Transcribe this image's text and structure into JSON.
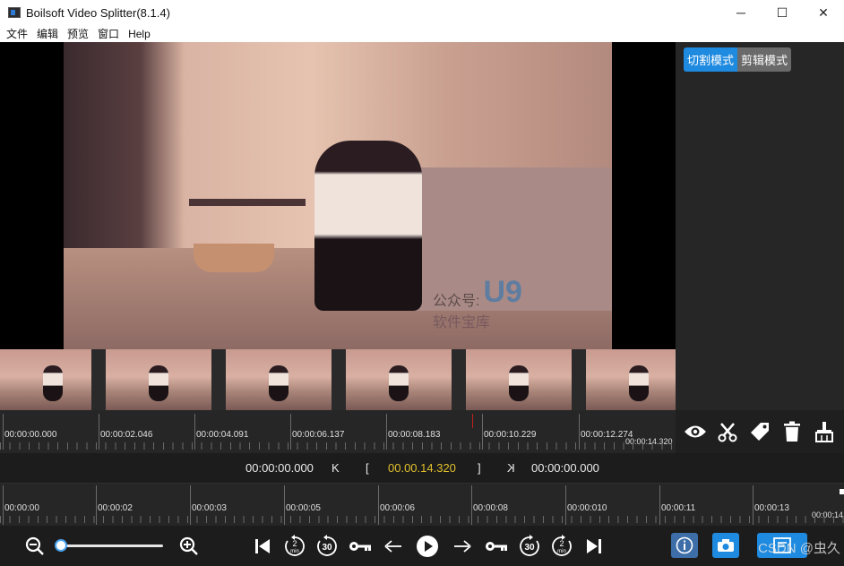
{
  "window": {
    "title": "Boilsoft Video Splitter(8.1.4)"
  },
  "window_controls": {
    "minimize": "─",
    "maximize": "☐",
    "close": "✕"
  },
  "menu": {
    "items": [
      "文件",
      "编辑",
      "预览",
      "窗口",
      "Help"
    ]
  },
  "video": {
    "watermark_logo": "U9",
    "watermark_text": "软件宝库",
    "watermark_left": "公众号:"
  },
  "mode": {
    "split_label": "切割模式",
    "edit_label": "剪辑模式",
    "active": "split"
  },
  "ruler_top": {
    "labels": [
      "00:00:00.000",
      "00:00:02.046",
      "00:00:04.091",
      "00:00:06.137",
      "00:00:08.183",
      "00:00:10.229",
      "00:00:12.274"
    ],
    "end_label": "00:00:14.320"
  },
  "tools": {
    "icons": [
      "eye-icon",
      "scissors-icon",
      "tag-icon",
      "trash-icon",
      "broom-icon"
    ]
  },
  "timebar": {
    "current": "00:00:00.000",
    "start_marker": "K",
    "bracket_open": "[",
    "duration": "00.00.14.320",
    "bracket_close": "]",
    "end_marker": "K",
    "end_time": "00:00:00.000",
    "duration_color": "#e2c02c"
  },
  "ruler_bottom": {
    "labels": [
      "00:00:00",
      "00:00:02",
      "00:00:03",
      "00:00:05",
      "00:00:06",
      "00:00:08",
      "00:00:010",
      "00:00:11",
      "00:00:13"
    ],
    "end_label": "00:00:14"
  },
  "controls": {
    "zoom_level": 0.03,
    "rewind_label_2": "2",
    "rewind_unit": "min",
    "rewind_label_30": "30",
    "forward_label_30": "30",
    "forward_label_2": "2",
    "forward_unit": "min",
    "icons": [
      "zoom-out-icon",
      "zoom-in-icon",
      "skip-start-icon",
      "rewind-2min-icon",
      "rewind-30s-icon",
      "key-start-icon",
      "arrow-left-icon",
      "play-icon",
      "arrow-right-icon",
      "key-end-icon",
      "forward-30s-icon",
      "forward-2min-icon",
      "skip-end-icon",
      "info-icon",
      "camera-icon",
      "export-icon"
    ]
  },
  "footer_watermark": "CSDN @虫久",
  "colors": {
    "accent": "#1e8ae0",
    "highlight": "#e2c02c",
    "background": "#1f1f1f"
  }
}
